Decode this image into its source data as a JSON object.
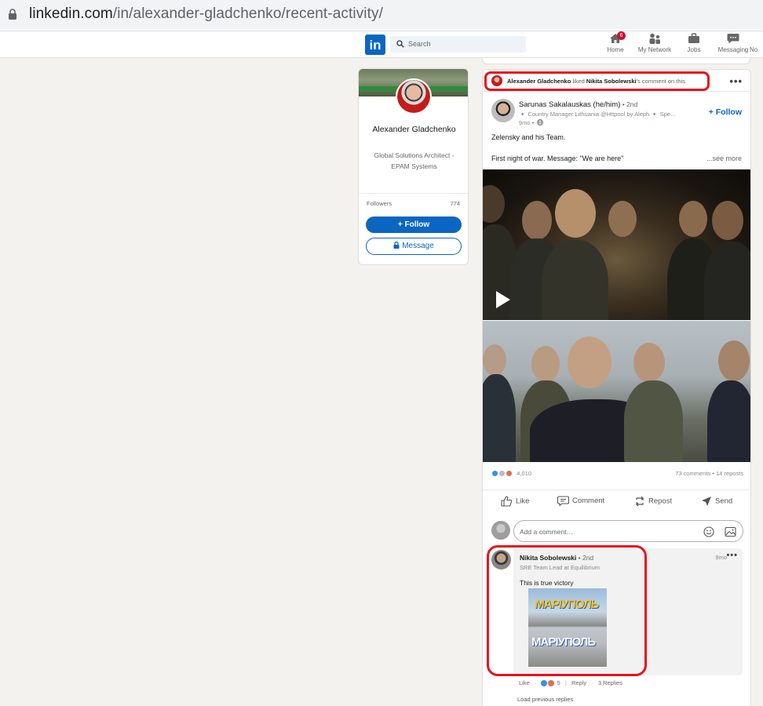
{
  "browser": {
    "url_domain": "linkedin.com",
    "url_path": "/in/alexander-gladchenko/recent-activity/"
  },
  "nav": {
    "logo_text": "in",
    "search_placeholder": "Search",
    "items": [
      {
        "label": "Home",
        "icon": "home-icon",
        "badge": "6"
      },
      {
        "label": "My Network",
        "icon": "network-icon"
      },
      {
        "label": "Jobs",
        "icon": "briefcase-icon"
      },
      {
        "label": "Messaging",
        "icon": "chat-icon"
      },
      {
        "label": "No",
        "icon": "bell-icon"
      }
    ]
  },
  "profile": {
    "name": "Alexander Gladchenko",
    "headline": "Global Solutions Architect - EPAM Systems",
    "followers_label": "Followers",
    "followers_count": "774",
    "follow_button": "+ Follow",
    "message_button": "Message"
  },
  "activity": {
    "actor": "Alexander Gladchenko",
    "verb": " liked ",
    "target": "Nikita Sobolewski",
    "suffix": "'s comment on this",
    "more": "•••"
  },
  "post": {
    "author": "Sarunas Sakalauskas (he/him)",
    "degree": " • 2nd",
    "subtitle": "🔹 Country Manager Lithuania @Httpool by Aleph 🔹 Spe...",
    "time": "9mo •",
    "follow": "+ Follow",
    "text_line1": "Zelensky and his Team.",
    "text_line2": "First night of war. Message: \"We are here\"",
    "see_more": "...see more",
    "reactions_count": "4,010",
    "comments_reposts": "73 comments • 14 reposts",
    "actions": [
      {
        "label": "Like",
        "icon": "thumbs-up-icon"
      },
      {
        "label": "Comment",
        "icon": "comment-icon"
      },
      {
        "label": "Repost",
        "icon": "repost-icon"
      },
      {
        "label": "Send",
        "icon": "send-icon"
      }
    ],
    "comment_placeholder": "Add a comment…"
  },
  "comment": {
    "author": "Nikita Sobolewski",
    "degree": " • 2nd",
    "headline": "SRE Team Lead at Equilibrium",
    "time": "9mo",
    "more": "•••",
    "body": "This is true victory",
    "sign_top": "МАРІУПОЛЬ",
    "sign_bottom": "МАРІУПОЛЬ",
    "like": "Like",
    "reaction_count": "5",
    "reply": "Reply",
    "replies": "3 Replies",
    "load_previous": "Load previous replies"
  },
  "colors": {
    "brand": "#0a66c2",
    "highlight": "#e8121c",
    "background": "#f3f2ef"
  }
}
